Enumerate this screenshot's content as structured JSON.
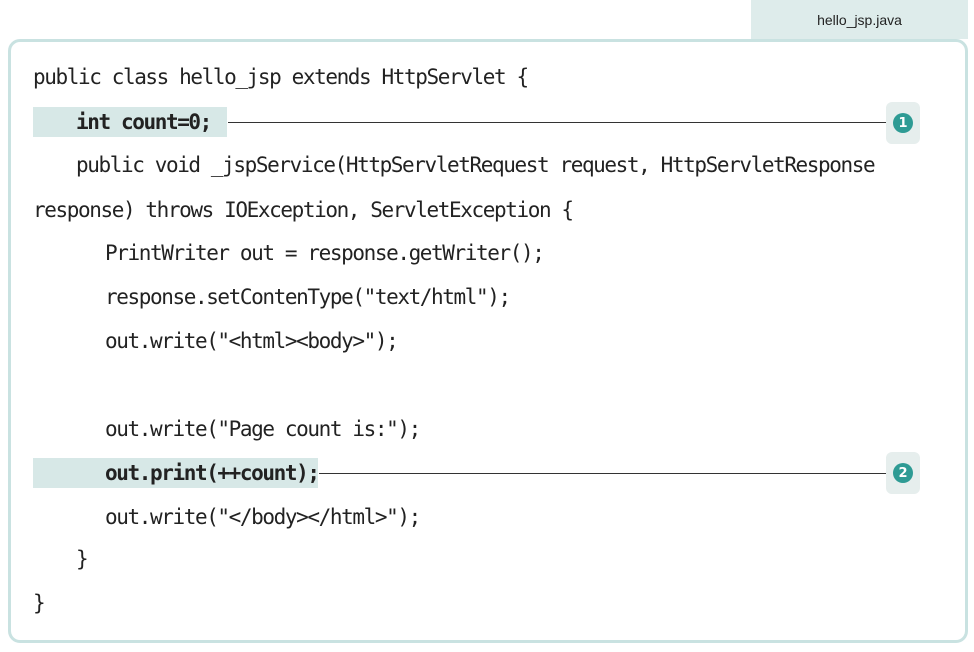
{
  "file_label": "hello_jsp.java",
  "code": {
    "l1": "public class hello_jsp extends HttpServlet {",
    "l2": "int count=0;",
    "l3": "public void _jspService(HttpServletRequest request, HttpServletResponse",
    "l4": "response) throws IOException, ServletException {",
    "l5": "PrintWriter out = response.getWriter();",
    "l6": "response.setContenType(\"text/html\");",
    "l7": "out.write(\"<html><body>\");",
    "l8": "",
    "l9": "out.write(\"Page count is:\");",
    "l10": "out.print(++count);",
    "l11": "out.write(\"</body></html>\");",
    "l12": "}",
    "l13": "}"
  },
  "callouts": {
    "c1": "1",
    "c2": "2"
  },
  "colors": {
    "highlight": "#d7e8e7",
    "marker": "#2e9b94",
    "border": "#c9e2e1"
  }
}
